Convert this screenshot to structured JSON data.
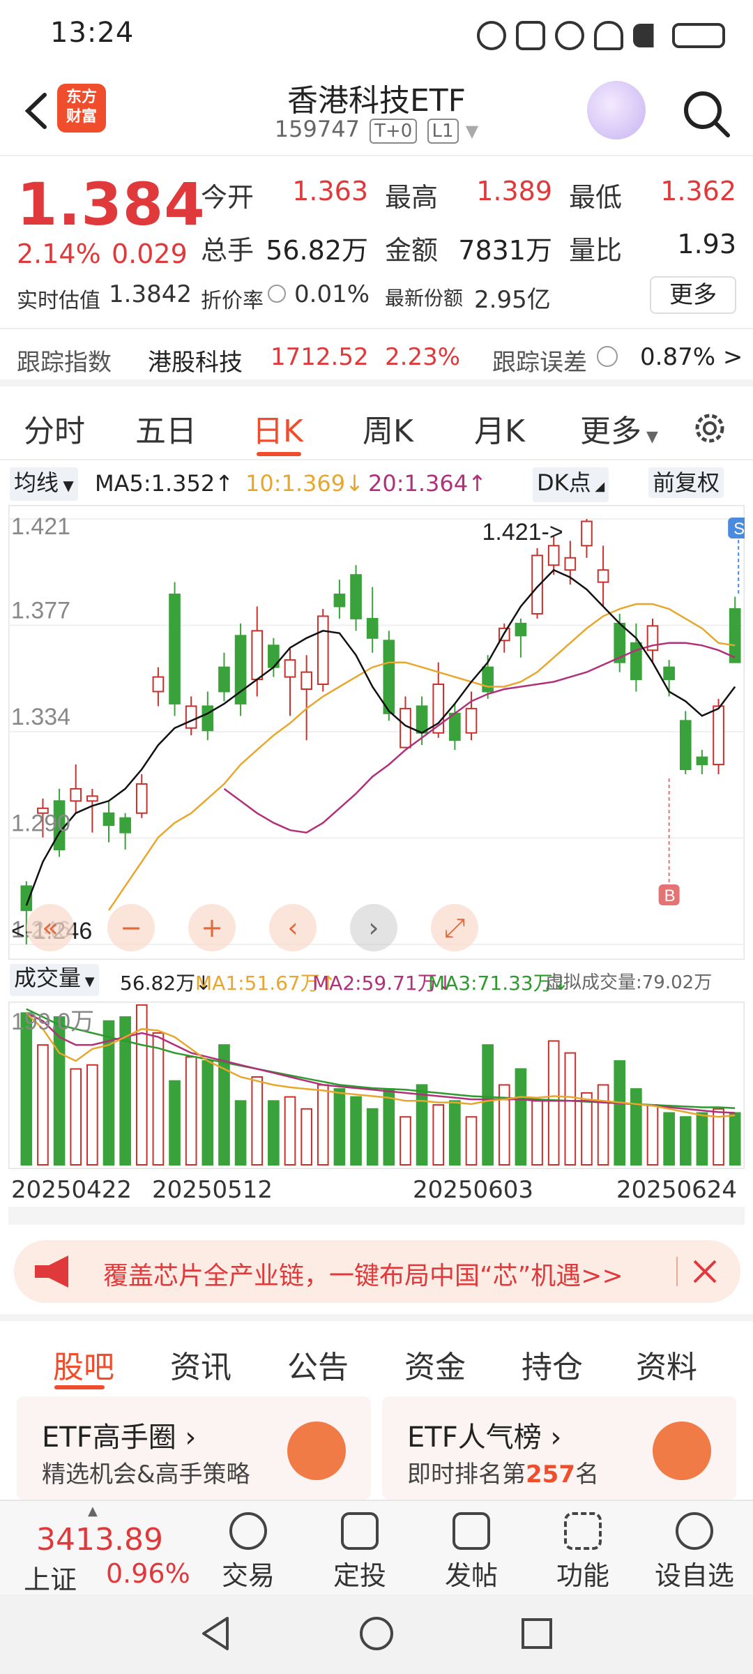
{
  "status": {
    "time": "13:24"
  },
  "header": {
    "logo_line1": "东方",
    "logo_line2": "财富",
    "title": "香港科技ETF",
    "code": "159747",
    "tag1": "T+0",
    "tag2": "L1"
  },
  "quote": {
    "price": "1.384",
    "pct": "2.14%",
    "change": "0.029",
    "open_label": "今开",
    "open": "1.363",
    "high_label": "最高",
    "high": "1.389",
    "low_label": "最低",
    "low": "1.362",
    "vol_label": "总手",
    "vol": "56.82万",
    "amount_label": "金额",
    "amount": "7831万",
    "ratio_label": "量比",
    "ratio": "1.93",
    "iopv_label": "实时估值",
    "iopv": "1.3842",
    "discount_label": "折价率",
    "discount": "0.01%",
    "shares_label": "最新份额",
    "shares": "2.95亿",
    "more": "更多"
  },
  "tracking": {
    "label": "跟踪指数",
    "index": "港股科技",
    "value": "1712.52",
    "pct": "2.23%",
    "err_label": "跟踪误差",
    "err": "0.87% >"
  },
  "tabs": [
    "分时",
    "五日",
    "日K",
    "周K",
    "月K",
    "更多"
  ],
  "ma": {
    "select": "均线",
    "ma5": "MA5:1.352↑",
    "ma10": "10:1.369↓",
    "ma20": "20:1.364↑",
    "dk": "DK点",
    "adjust": "前复权",
    "ma5_color": "#111111",
    "ma10_color": "#e8a72c",
    "ma20_color": "#b0307a"
  },
  "vol_legend": {
    "select": "成交量",
    "vol": "56.82万↓",
    "ma1": "MA1:51.67万↑",
    "ma2": "MA2:59.71万↓",
    "ma3": "MA3:71.33万↓",
    "virtual": "虚拟成交量:79.02万"
  },
  "chart_data": {
    "type": "candlestick",
    "ylim": [
      1.246,
      1.421
    ],
    "yticks": [
      "1.421",
      "1.377",
      "1.334",
      "1.290",
      "1.246"
    ],
    "max_label": "1.421->",
    "min_label": "<-1.246",
    "vol_max_label": "199.0万",
    "dates": [
      "20250422",
      "20250512",
      "20250603",
      "20250624"
    ],
    "candles": [
      [
        1.27,
        1.26,
        1.272,
        1.246
      ],
      [
        1.3,
        1.302,
        1.306,
        1.29
      ],
      [
        1.305,
        1.285,
        1.31,
        1.282
      ],
      [
        1.305,
        1.31,
        1.32,
        1.3
      ],
      [
        1.305,
        1.307,
        1.31,
        1.292
      ],
      [
        1.3,
        1.295,
        1.305,
        1.288
      ],
      [
        1.298,
        1.292,
        1.3,
        1.285
      ],
      [
        1.3,
        1.312,
        1.316,
        1.298
      ],
      [
        1.35,
        1.356,
        1.36,
        1.344
      ],
      [
        1.39,
        1.345,
        1.395,
        1.34
      ],
      [
        1.335,
        1.344,
        1.348,
        1.332
      ],
      [
        1.344,
        1.334,
        1.35,
        1.33
      ],
      [
        1.36,
        1.35,
        1.366,
        1.346
      ],
      [
        1.373,
        1.345,
        1.378,
        1.34
      ],
      [
        1.355,
        1.375,
        1.385,
        1.348
      ],
      [
        1.369,
        1.36,
        1.372,
        1.356
      ],
      [
        1.356,
        1.363,
        1.368,
        1.34
      ],
      [
        1.351,
        1.358,
        1.365,
        1.33
      ],
      [
        1.353,
        1.381,
        1.384,
        1.35
      ],
      [
        1.39,
        1.385,
        1.396,
        1.38
      ],
      [
        1.398,
        1.38,
        1.402,
        1.375
      ],
      [
        1.38,
        1.372,
        1.393,
        1.366
      ],
      [
        1.371,
        1.341,
        1.375,
        1.338
      ],
      [
        1.327,
        1.343,
        1.348,
        1.327
      ],
      [
        1.344,
        1.333,
        1.348,
        1.328
      ],
      [
        1.333,
        1.353,
        1.362,
        1.331
      ],
      [
        1.341,
        1.33,
        1.345,
        1.326
      ],
      [
        1.333,
        1.343,
        1.35,
        1.33
      ],
      [
        1.36,
        1.35,
        1.365,
        1.347
      ],
      [
        1.371,
        1.376,
        1.378,
        1.366
      ],
      [
        1.378,
        1.373,
        1.38,
        1.364
      ],
      [
        1.382,
        1.406,
        1.409,
        1.38
      ],
      [
        1.402,
        1.41,
        1.414,
        1.398
      ],
      [
        1.4,
        1.405,
        1.412,
        1.394
      ],
      [
        1.41,
        1.42,
        1.421,
        1.405
      ],
      [
        1.395,
        1.4,
        1.41,
        1.385
      ],
      [
        1.378,
        1.362,
        1.382,
        1.358
      ],
      [
        1.37,
        1.355,
        1.378,
        1.35
      ],
      [
        1.367,
        1.377,
        1.38,
        1.362
      ],
      [
        1.36,
        1.355,
        1.363,
        1.348
      ],
      [
        1.338,
        1.318,
        1.342,
        1.316
      ],
      [
        1.323,
        1.32,
        1.326,
        1.316
      ],
      [
        1.32,
        1.344,
        1.347,
        1.316
      ],
      [
        1.384,
        1.362,
        1.389,
        1.362
      ]
    ],
    "ma5": [
      1.262,
      1.28,
      1.292,
      1.3,
      1.303,
      1.305,
      1.31,
      1.318,
      1.328,
      1.335,
      1.338,
      1.341,
      1.345,
      1.35,
      1.355,
      1.36,
      1.368,
      1.372,
      1.375,
      1.374,
      1.365,
      1.352,
      1.342,
      1.336,
      1.333,
      1.337,
      1.345,
      1.354,
      1.362,
      1.374,
      1.385,
      1.393,
      1.4,
      1.397,
      1.392,
      1.385,
      1.378,
      1.372,
      1.362,
      1.35,
      1.346,
      1.34,
      1.343,
      1.352
    ],
    "ma10": [
      1.26,
      1.27,
      1.28,
      1.29,
      1.296,
      1.3,
      1.306,
      1.312,
      1.32,
      1.326,
      1.332,
      1.337,
      1.343,
      1.348,
      1.352,
      1.356,
      1.36,
      1.362,
      1.362,
      1.36,
      1.358,
      1.356,
      1.354,
      1.352,
      1.352,
      1.354,
      1.358,
      1.364,
      1.37,
      1.376,
      1.381,
      1.384,
      1.386,
      1.386,
      1.384,
      1.38,
      1.376,
      1.37,
      1.369
    ],
    "ma20": [
      1.31,
      1.305,
      1.3,
      1.296,
      1.293,
      1.292,
      1.296,
      1.302,
      1.308,
      1.315,
      1.32,
      1.326,
      1.331,
      1.336,
      1.341,
      1.346,
      1.349,
      1.351,
      1.352,
      1.353,
      1.354,
      1.356,
      1.358,
      1.361,
      1.364,
      1.367,
      1.369,
      1.37,
      1.37,
      1.369,
      1.367,
      1.364
    ],
    "volumes": [
      190,
      150,
      185,
      120,
      125,
      180,
      185,
      200,
      165,
      105,
      135,
      130,
      150,
      80,
      110,
      80,
      85,
      70,
      100,
      95,
      85,
      70,
      95,
      60,
      100,
      75,
      80,
      60,
      150,
      100,
      120,
      80,
      155,
      140,
      90,
      100,
      130,
      95,
      75,
      65,
      60,
      65,
      70,
      65
    ],
    "vol_ma1": [
      190,
      170,
      140,
      130,
      145,
      150,
      160,
      170,
      168,
      160,
      145,
      130,
      120,
      110,
      105,
      100,
      97,
      95,
      93,
      90,
      88,
      86,
      84,
      80,
      80,
      78,
      78,
      76,
      80,
      82,
      85,
      84,
      86,
      85,
      82,
      80,
      78,
      76,
      74,
      70,
      66,
      62,
      60,
      62
    ],
    "vol_ma2": [
      190,
      180,
      160,
      150,
      150,
      155,
      160,
      165,
      160,
      150,
      140,
      135,
      130,
      125,
      120,
      115,
      110,
      105,
      100,
      98,
      96,
      94,
      92,
      90,
      88,
      86,
      84,
      82,
      82,
      82,
      82,
      80,
      80,
      80,
      80,
      78,
      77,
      76,
      74,
      72,
      70,
      68,
      66,
      65
    ],
    "vol_ma3": [
      195,
      185,
      175,
      170,
      165,
      160,
      155,
      150,
      146,
      140,
      136,
      132,
      128,
      124,
      120,
      116,
      112,
      108,
      104,
      100,
      98,
      96,
      95,
      94,
      92,
      90,
      88,
      86,
      85,
      84,
      83,
      82,
      81,
      80,
      79,
      78,
      77,
      76,
      75,
      74,
      73,
      72,
      72,
      71
    ]
  },
  "banner": {
    "text": "覆盖芯片全产业链，一键布局中国“芯”机遇>>"
  },
  "sec_tabs": [
    "股吧",
    "资讯",
    "公告",
    "资金",
    "持仓",
    "资料"
  ],
  "cards": [
    {
      "title": "ETF高手圈 ›",
      "sub": "精选机会&高手策略",
      "sub_hl": ""
    },
    {
      "title": "ETF人气榜 ›",
      "sub": "即时排名第",
      "sub_hl": "257",
      "sub_end": "名"
    }
  ],
  "toolbar": {
    "index_value": "3413.89",
    "index_name": "上证",
    "index_pct": "0.96%",
    "items": [
      "交易",
      "定投",
      "发帖",
      "功能",
      "设自选"
    ]
  }
}
